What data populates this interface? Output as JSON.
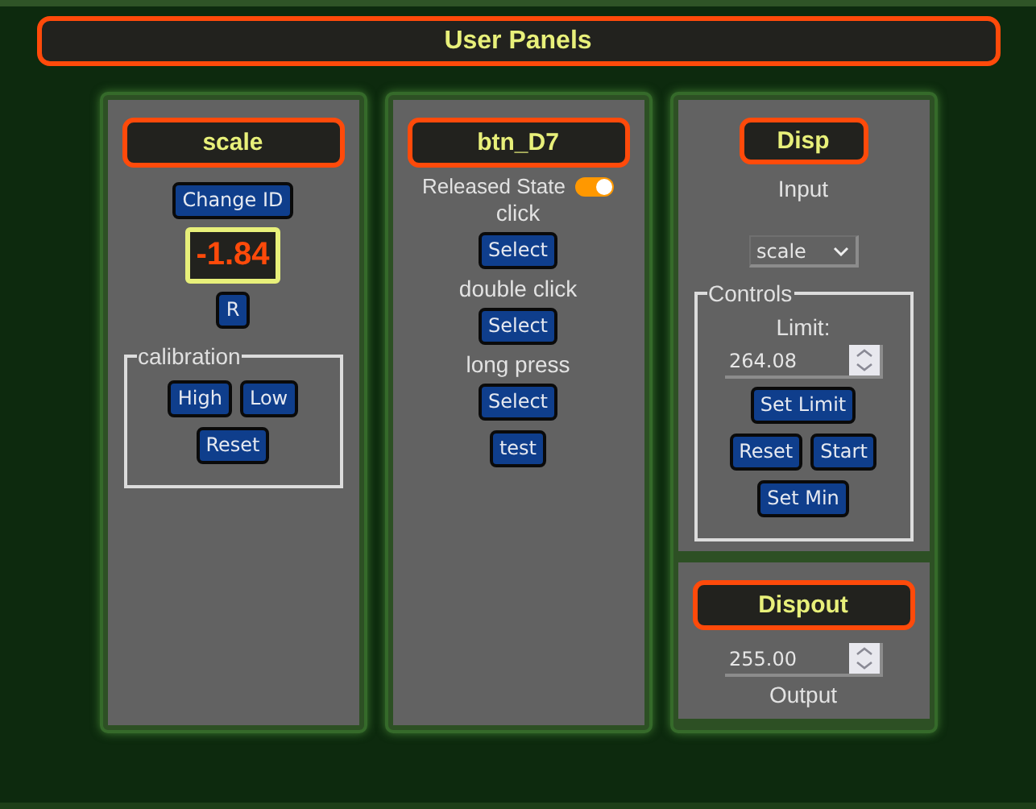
{
  "header": {
    "title": "User Panels"
  },
  "panels": [
    {
      "sections": [
        {
          "title": "scale",
          "items": [
            {
              "kind": "buttons",
              "buttons": [
                "Change ID"
              ]
            },
            {
              "kind": "display",
              "value": "-1.84"
            },
            {
              "kind": "buttons",
              "buttons": [
                "R"
              ]
            },
            {
              "kind": "group",
              "legend": "calibration",
              "items": [
                {
                  "kind": "buttons",
                  "buttons": [
                    "High",
                    "Low"
                  ]
                },
                {
                  "kind": "buttons",
                  "buttons": [
                    "Reset"
                  ]
                }
              ]
            }
          ]
        }
      ]
    },
    {
      "sections": [
        {
          "title": "btn_D7",
          "items": [
            {
              "kind": "toggle",
              "label": "Released State",
              "on": true
            },
            {
              "kind": "label",
              "text": "click"
            },
            {
              "kind": "buttons",
              "buttons": [
                "Select"
              ]
            },
            {
              "kind": "label",
              "text": "double click"
            },
            {
              "kind": "buttons",
              "buttons": [
                "Select"
              ]
            },
            {
              "kind": "label",
              "text": "long press"
            },
            {
              "kind": "buttons",
              "buttons": [
                "Select"
              ]
            },
            {
              "kind": "buttons",
              "buttons": [
                "test"
              ]
            }
          ]
        }
      ]
    },
    {
      "sections": [
        {
          "title": "Disp",
          "items": [
            {
              "kind": "label",
              "text": "Input"
            },
            {
              "kind": "select",
              "value": "scale"
            },
            {
              "kind": "group",
              "legend": "Controls",
              "items": [
                {
                  "kind": "label",
                  "text": "Limit:"
                },
                {
                  "kind": "number",
                  "value": "264.08"
                },
                {
                  "kind": "buttons",
                  "buttons": [
                    "Set Limit"
                  ]
                },
                {
                  "kind": "buttons",
                  "buttons": [
                    "Reset",
                    "Start"
                  ]
                },
                {
                  "kind": "buttons",
                  "buttons": [
                    "Set Min"
                  ]
                }
              ]
            }
          ]
        },
        {
          "title": "Dispout",
          "items": [
            {
              "kind": "number",
              "value": "255.00"
            },
            {
              "kind": "label",
              "text": "Output"
            }
          ]
        }
      ]
    }
  ]
}
